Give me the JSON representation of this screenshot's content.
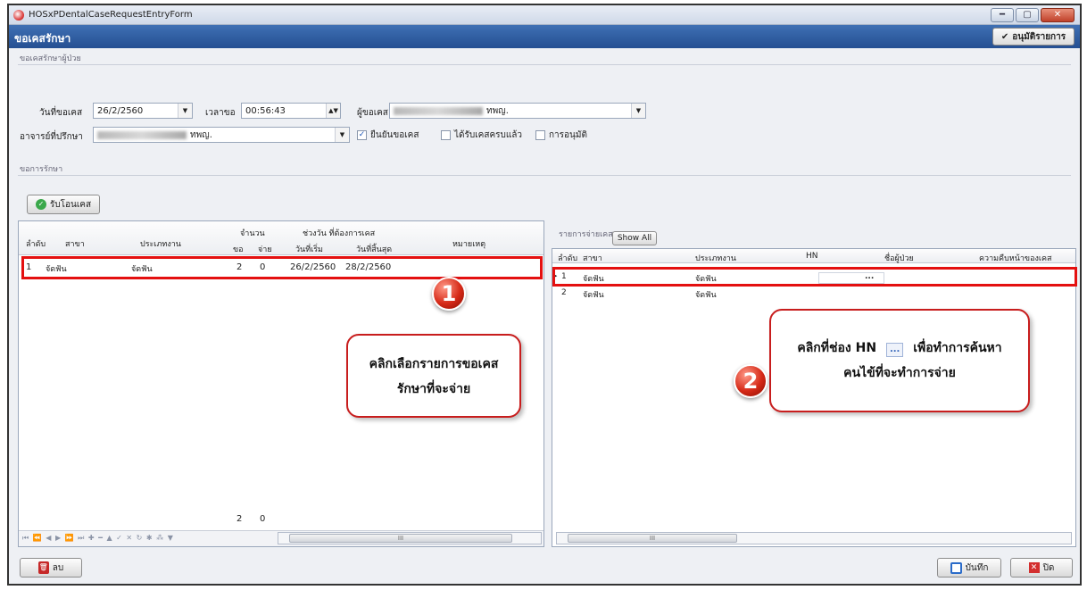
{
  "window": {
    "title": "HOSxPDentalCaseRequestEntryForm"
  },
  "header": {
    "title": "ขอเคสรักษา",
    "approve_label": "อนุมัติรายการ"
  },
  "patient_request": {
    "group_label": "ขอเคสรักษาผู้ป่วย",
    "date_label": "วันที่ขอเคส",
    "date_value": "26/2/2560",
    "time_label": "เวลาขอ",
    "time_value": "00:56:43",
    "requester_label": "ผู้ขอเคส",
    "requester_suffix": "ทพญ.",
    "advisor_label": "อาจารย์ที่ปรึกษา",
    "advisor_suffix": "ทพญ.",
    "confirm_label": "ยืนยันขอเคส",
    "received_label": "ได้รับเคสครบแล้ว",
    "approval_label": "การอนุมัติ"
  },
  "treatment_request": {
    "group_label": "ขอการรักษา",
    "receive_button": "รับโอนเคส"
  },
  "left_grid": {
    "headers": {
      "no": "ลำดับ",
      "branch": "สาขา",
      "type": "ประเภทงาน",
      "amount": "จำนวน",
      "amount_req": "ขอ",
      "amount_paid": "จ่าย",
      "period": "ช่วงวัน ที่ต้องการเคส",
      "start": "วันที่เริ่ม",
      "end": "วันที่สิ้นสุด",
      "note": "หมายเหตุ"
    },
    "rows": [
      {
        "no": "1",
        "branch": "จัดฟัน",
        "type": "จัดฟัน",
        "req": "2",
        "paid": "0",
        "start": "26/2/2560",
        "end": "28/2/2560",
        "note": ""
      }
    ],
    "total_req": "2",
    "total_paid": "0",
    "nav": "⏮ ⏪ ◀ ▶ ⏩ ⏭ ✚ ━ ▲ ✓ ✕ ↻ ✱ ⁂ ▼"
  },
  "right_grid": {
    "group_label": "รายการจ่ายเคส",
    "show_all": "Show All",
    "headers": {
      "no": "ลำดับ",
      "branch": "สาขา",
      "type": "ประเภทงาน",
      "hn": "HN",
      "patient": "ชื่อผู้ป่วย",
      "progress": "ความคืบหน้าของเคส"
    },
    "rows": [
      {
        "no": "1",
        "branch": "จัดฟัน",
        "type": "จัดฟัน",
        "hn": "",
        "hn_btn": "...",
        "patient": ""
      },
      {
        "no": "2",
        "branch": "จัดฟัน",
        "type": "จัดฟัน",
        "hn": "",
        "hn_btn": "",
        "patient": ""
      }
    ]
  },
  "footer": {
    "delete_label": "ลบ",
    "save_label": "บันทึก",
    "close_label": "ปิด"
  },
  "callouts": {
    "one_badge": "1",
    "one_line1": "คลิกเลือกรายการขอเคส",
    "one_line2": "รักษาที่จะจ่าย",
    "two_badge": "2",
    "two_line1_a": "คลิกที่ช่อง HN",
    "two_line1_b": "เพื่อทำการค้นหา",
    "two_line2": "คนไข้ที่จะทำการจ่าย",
    "two_icon": "..."
  },
  "scroll_glyph": "III"
}
